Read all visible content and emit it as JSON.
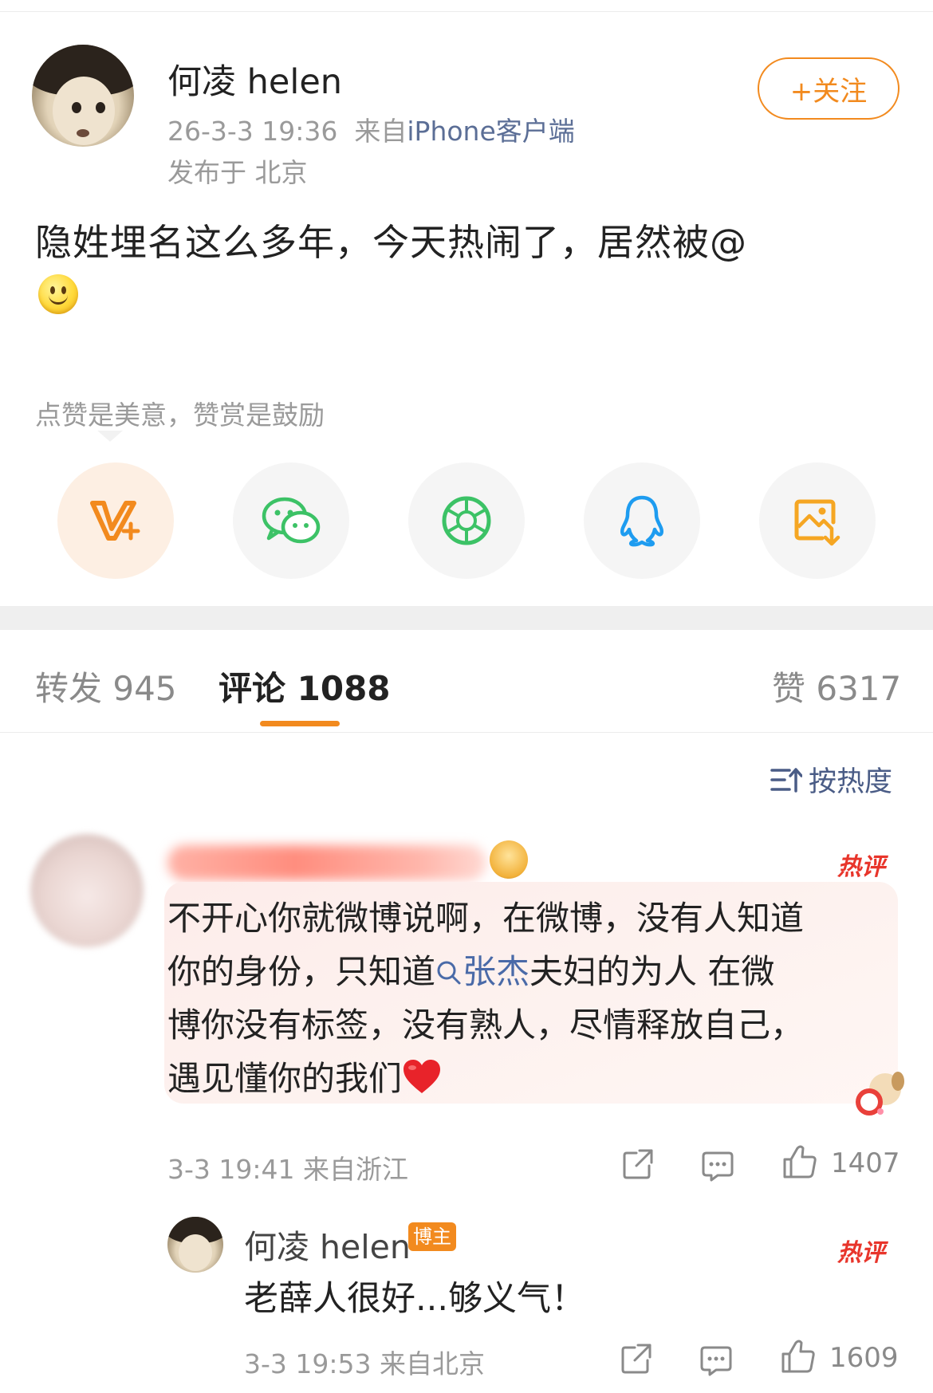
{
  "post": {
    "username": "何凌 helen",
    "time": "26-3-3 19:36",
    "source_prefix": "来自",
    "source": "iPhone客户端",
    "location": "发布于 北京",
    "follow_label": "+关注",
    "text": "隐姓埋名这么多年，今天热闹了，居然被@",
    "emoji": "smile-emoji"
  },
  "reward": {
    "text": "点赞是美意，赞赏是鼓励"
  },
  "share_icons": [
    "reward-v-icon",
    "wechat-icon",
    "moments-icon",
    "qq-icon",
    "save-image-icon"
  ],
  "colors": {
    "accent": "#f28a1e",
    "link": "#4a6aa8",
    "hot": "#e8352b"
  },
  "tabs": {
    "repost": "转发 945",
    "comment": "评论 1088",
    "like": "赞 6317"
  },
  "sort": {
    "label": "按热度"
  },
  "comment1": {
    "hot_tag": "热评",
    "line1": "不开心你就微博说啊，在微博，没有人知道",
    "line2_a": "你的身份，只知道",
    "link": "张杰",
    "line2_b": "夫妇的为人  在微",
    "line3": "博你没有标签，没有熟人，尽情释放自己，",
    "line4": "遇见懂你的我们",
    "meta": "3-3 19:41 来自浙江",
    "likes": "1407"
  },
  "reply": {
    "username": "何凌 helen",
    "badge": "博主",
    "hot_tag": "热评",
    "text": "老薛人很好...够义气！",
    "meta": "3-3 19:53 来自北京",
    "likes": "1609"
  }
}
